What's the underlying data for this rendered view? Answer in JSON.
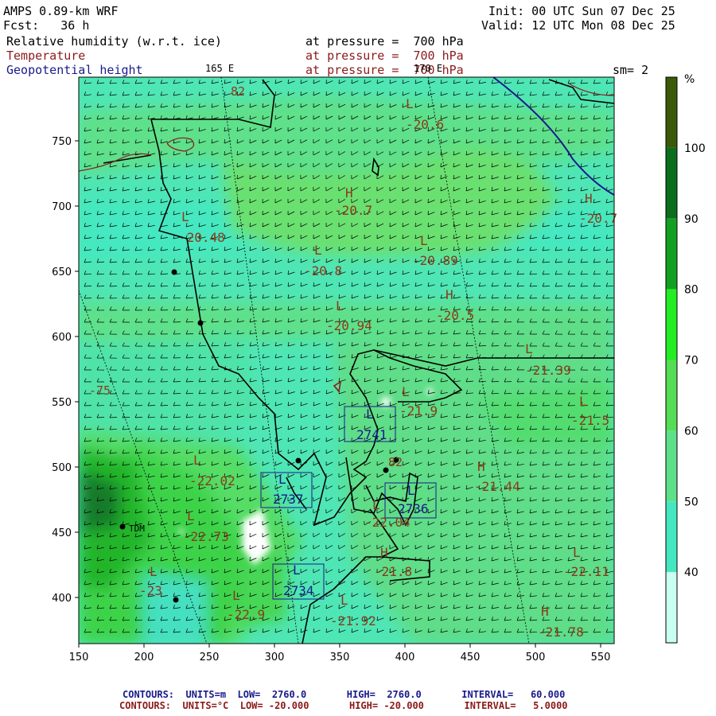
{
  "header": {
    "model": "AMPS 0.89-km WRF",
    "forecast": "Fcst:   36 h",
    "init": "Init: 00 UTC Sun 07 Dec 25",
    "valid": "Valid: 12 UTC Mon 08 Dec 25",
    "fields": [
      {
        "name": "Relative humidity (w.r.t. ice)",
        "level": "at pressure =  700 hPa"
      },
      {
        "name": "Temperature",
        "level": "at pressure =  700 hPa"
      },
      {
        "name": "Geopotential height",
        "level": "at pressure =  700 hPa"
      }
    ],
    "smoothing": "sm= 2",
    "lon_label_left": "165 E",
    "lon_label_right": "170 E"
  },
  "axes": {
    "x_ticks": [
      "150",
      "200",
      "250",
      "300",
      "350",
      "400",
      "450",
      "500",
      "550"
    ],
    "y_ticks": [
      "750",
      "700",
      "650",
      "600",
      "550",
      "500",
      "450",
      "400"
    ]
  },
  "colorbar": {
    "unit": "%",
    "labels": [
      "100",
      "90",
      "80",
      "70",
      "60",
      "50",
      "40"
    ],
    "colors": [
      "#3a5a0a",
      "#0b6e1c",
      "#13a022",
      "#22ee22",
      "#55dd55",
      "#5ee08a",
      "#44e8c0",
      "#c8fff0"
    ]
  },
  "temperature_labels": [
    {
      "letter": "L",
      "value": "-20.6"
    },
    {
      "letter": "H",
      "value": "-20.7"
    },
    {
      "letter": "H",
      "value": "-20.7"
    },
    {
      "letter": "L",
      "value": "-20.48"
    },
    {
      "letter": "L",
      "value": "-20.8"
    },
    {
      "letter": "L",
      "value": "-20.89"
    },
    {
      "letter": "L",
      "value": "-20.94"
    },
    {
      "letter": "H",
      "value": "-20.5"
    },
    {
      "letter": "L",
      "value": "-21.39"
    },
    {
      "letter": "L",
      "value": "-21.9"
    },
    {
      "letter": "L",
      "value": "-21.5"
    },
    {
      "letter": "L",
      "value": "-22.02"
    },
    {
      "letter": "H",
      "value": "-21.44"
    },
    {
      "letter": "L",
      "value": "-22.04"
    },
    {
      "letter": "L",
      "value": "-22.73"
    },
    {
      "letter": "H",
      "value": "-21.8"
    },
    {
      "letter": "L",
      "value": "-22.11"
    },
    {
      "letter": "L",
      "value": "-23"
    },
    {
      "letter": "L",
      "value": "-22.9"
    },
    {
      "letter": "L",
      "value": "-21.92"
    },
    {
      "letter": "H",
      "value": "-21.78"
    }
  ],
  "height_labels": [
    "2741",
    "2737",
    "2736",
    "2734"
  ],
  "misc_labels": [
    "-75",
    "82",
    "82",
    "TDM"
  ],
  "footer": {
    "line1": "CONTOURS:  UNITS=m  LOW=  2760.0       HIGH=  2760.0       INTERVAL=   60.000",
    "line2": "CONTOURS:  UNITS=°C  LOW= -20.000       HIGH= -20.000       INTERVAL=   5.0000"
  }
}
